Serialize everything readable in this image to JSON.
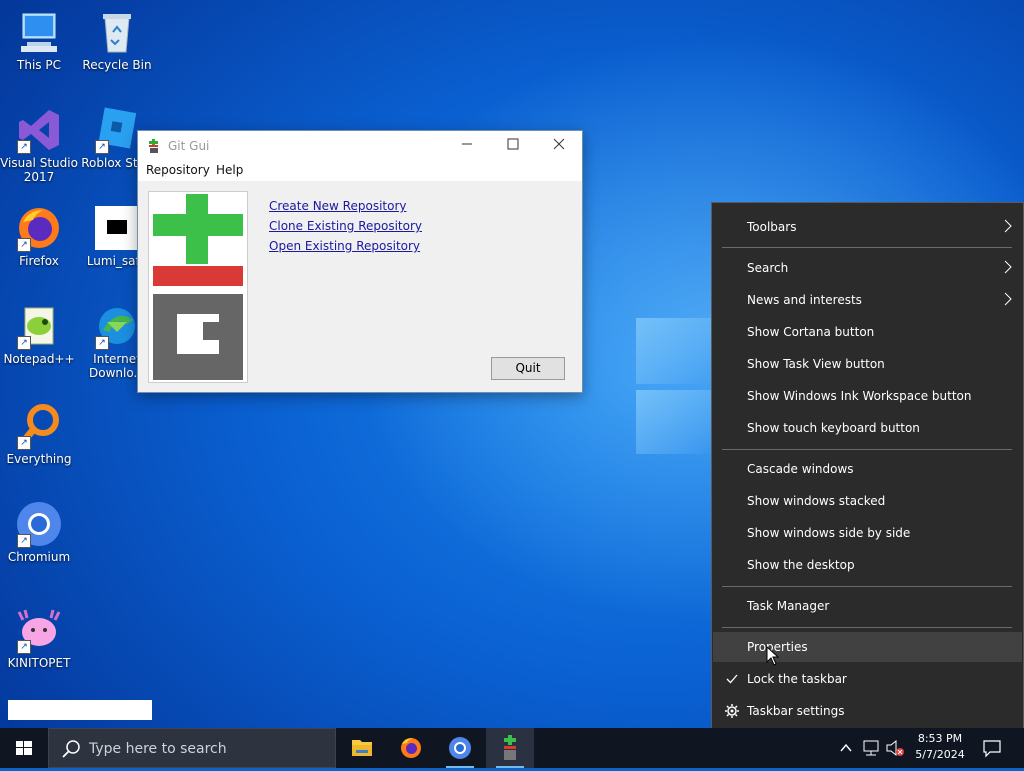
{
  "desktop": {
    "icons": [
      {
        "label": "This PC"
      },
      {
        "label": "Recycle Bin"
      },
      {
        "label": "Visual Studio 2017"
      },
      {
        "label": "Roblox Stud"
      },
      {
        "label": "Firefox"
      },
      {
        "label": "Lumi_safe"
      },
      {
        "label": "Notepad++"
      },
      {
        "label": "Internet Downlo..."
      },
      {
        "label": "Everything"
      },
      {
        "label": "Chromium"
      },
      {
        "label": "KINITOPET"
      }
    ]
  },
  "git_window": {
    "title": "Git Gui",
    "menu": [
      "Repository",
      "Help"
    ],
    "links": [
      "Create New Repository",
      "Clone Existing Repository",
      "Open Existing Repository"
    ],
    "quit_label": "Quit"
  },
  "context_menu": {
    "items": [
      {
        "label": "Toolbars"
      },
      {
        "label": "Search"
      },
      {
        "label": "News and interests"
      },
      {
        "label": "Show Cortana button"
      },
      {
        "label": "Show Task View button"
      },
      {
        "label": "Show Windows Ink Workspace button"
      },
      {
        "label": "Show touch keyboard button"
      },
      {
        "label": "Cascade windows"
      },
      {
        "label": "Show windows stacked"
      },
      {
        "label": "Show windows side by side"
      },
      {
        "label": "Show the desktop"
      },
      {
        "label": "Task Manager"
      },
      {
        "label": "Properties"
      },
      {
        "label": "Lock the taskbar"
      },
      {
        "label": "Taskbar settings"
      }
    ]
  },
  "taskbar": {
    "search_placeholder": "Type here to search",
    "time": "8:53 PM",
    "date": "5/7/2024"
  },
  "colors": {
    "menu_bg": "#2b2b2b",
    "menu_highlight": "#414141",
    "taskbar_bg": "#101621",
    "link": "#1a1aa0"
  }
}
